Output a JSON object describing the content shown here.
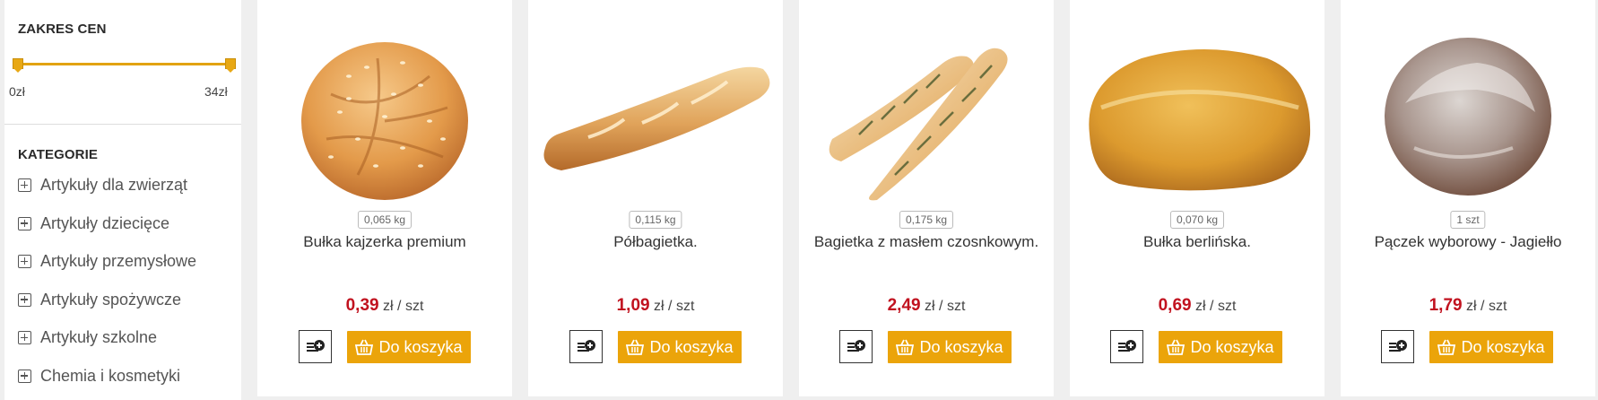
{
  "sidebar": {
    "price_title": "ZAKRES CEN",
    "price_min": "0zł",
    "price_max": "34zł",
    "categories_title": "KATEGORIE",
    "categories": [
      "Artykuły dla zwierząt",
      "Artykuły dziecięce",
      "Artykuły przemysłowe",
      "Artykuły spożywcze",
      "Artykuły szkolne",
      "Chemia i kosmetyki"
    ]
  },
  "products": [
    {
      "name": "Bułka kajzerka premium",
      "weight": "0,065 kg",
      "price": "0,39",
      "unit": "zł / szt",
      "cart_label": "Do koszyka",
      "image": "kaiser-roll"
    },
    {
      "name": "Półbagietka.",
      "weight": "0,115 kg",
      "price": "1,09",
      "unit": "zł / szt",
      "cart_label": "Do koszyka",
      "image": "half-baguette"
    },
    {
      "name": "Bagietka z masłem czosnkowym.",
      "weight": "0,175 kg",
      "price": "2,49",
      "unit": "zł / szt",
      "cart_label": "Do koszyka",
      "image": "garlic-baguettes"
    },
    {
      "name": "Bułka berlińska.",
      "weight": "0,070 kg",
      "price": "0,69",
      "unit": "zł / szt",
      "cart_label": "Do koszyka",
      "image": "berlin-roll"
    },
    {
      "name": "Pączek wyborowy - Jagiełło",
      "weight": "1 szt",
      "price": "1,79",
      "unit": "zł / szt",
      "cart_label": "Do koszyka",
      "image": "glazed-donut"
    }
  ],
  "colors": {
    "accent": "#eba40a",
    "price": "#c1121f",
    "slider": "#e2a311"
  }
}
